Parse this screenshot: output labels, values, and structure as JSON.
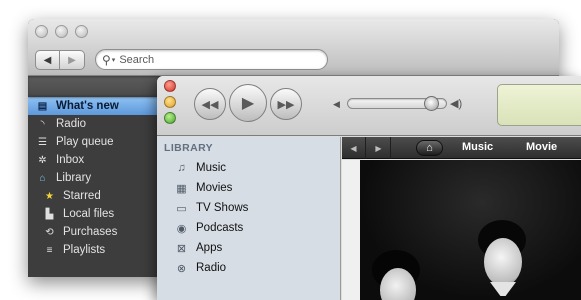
{
  "back_window": {
    "search": {
      "placeholder": "Search"
    },
    "sidebar": {
      "items": [
        {
          "label": "What's new",
          "icon": "whats-new-icon",
          "active": true
        },
        {
          "label": "Radio",
          "icon": "radio-icon"
        },
        {
          "label": "Play queue",
          "icon": "play-queue-icon"
        },
        {
          "label": "Inbox",
          "icon": "inbox-icon"
        },
        {
          "label": "Library",
          "icon": "library-icon"
        },
        {
          "label": "Starred",
          "icon": "star-icon"
        },
        {
          "label": "Local files",
          "icon": "local-files-icon"
        },
        {
          "label": "Purchases",
          "icon": "purchases-icon"
        },
        {
          "label": "Playlists",
          "icon": "playlists-icon"
        }
      ]
    }
  },
  "front_window": {
    "volume_level": 0.9,
    "library": {
      "heading": "LIBRARY",
      "items": [
        {
          "label": "Music",
          "icon": "music-note-icon"
        },
        {
          "label": "Movies",
          "icon": "film-icon"
        },
        {
          "label": "TV Shows",
          "icon": "tv-icon"
        },
        {
          "label": "Podcasts",
          "icon": "podcast-icon"
        },
        {
          "label": "Apps",
          "icon": "apps-icon"
        },
        {
          "label": "Radio",
          "icon": "radio-tower-icon"
        }
      ]
    },
    "store_nav": {
      "tabs": [
        "Music",
        "Movie"
      ]
    }
  }
}
